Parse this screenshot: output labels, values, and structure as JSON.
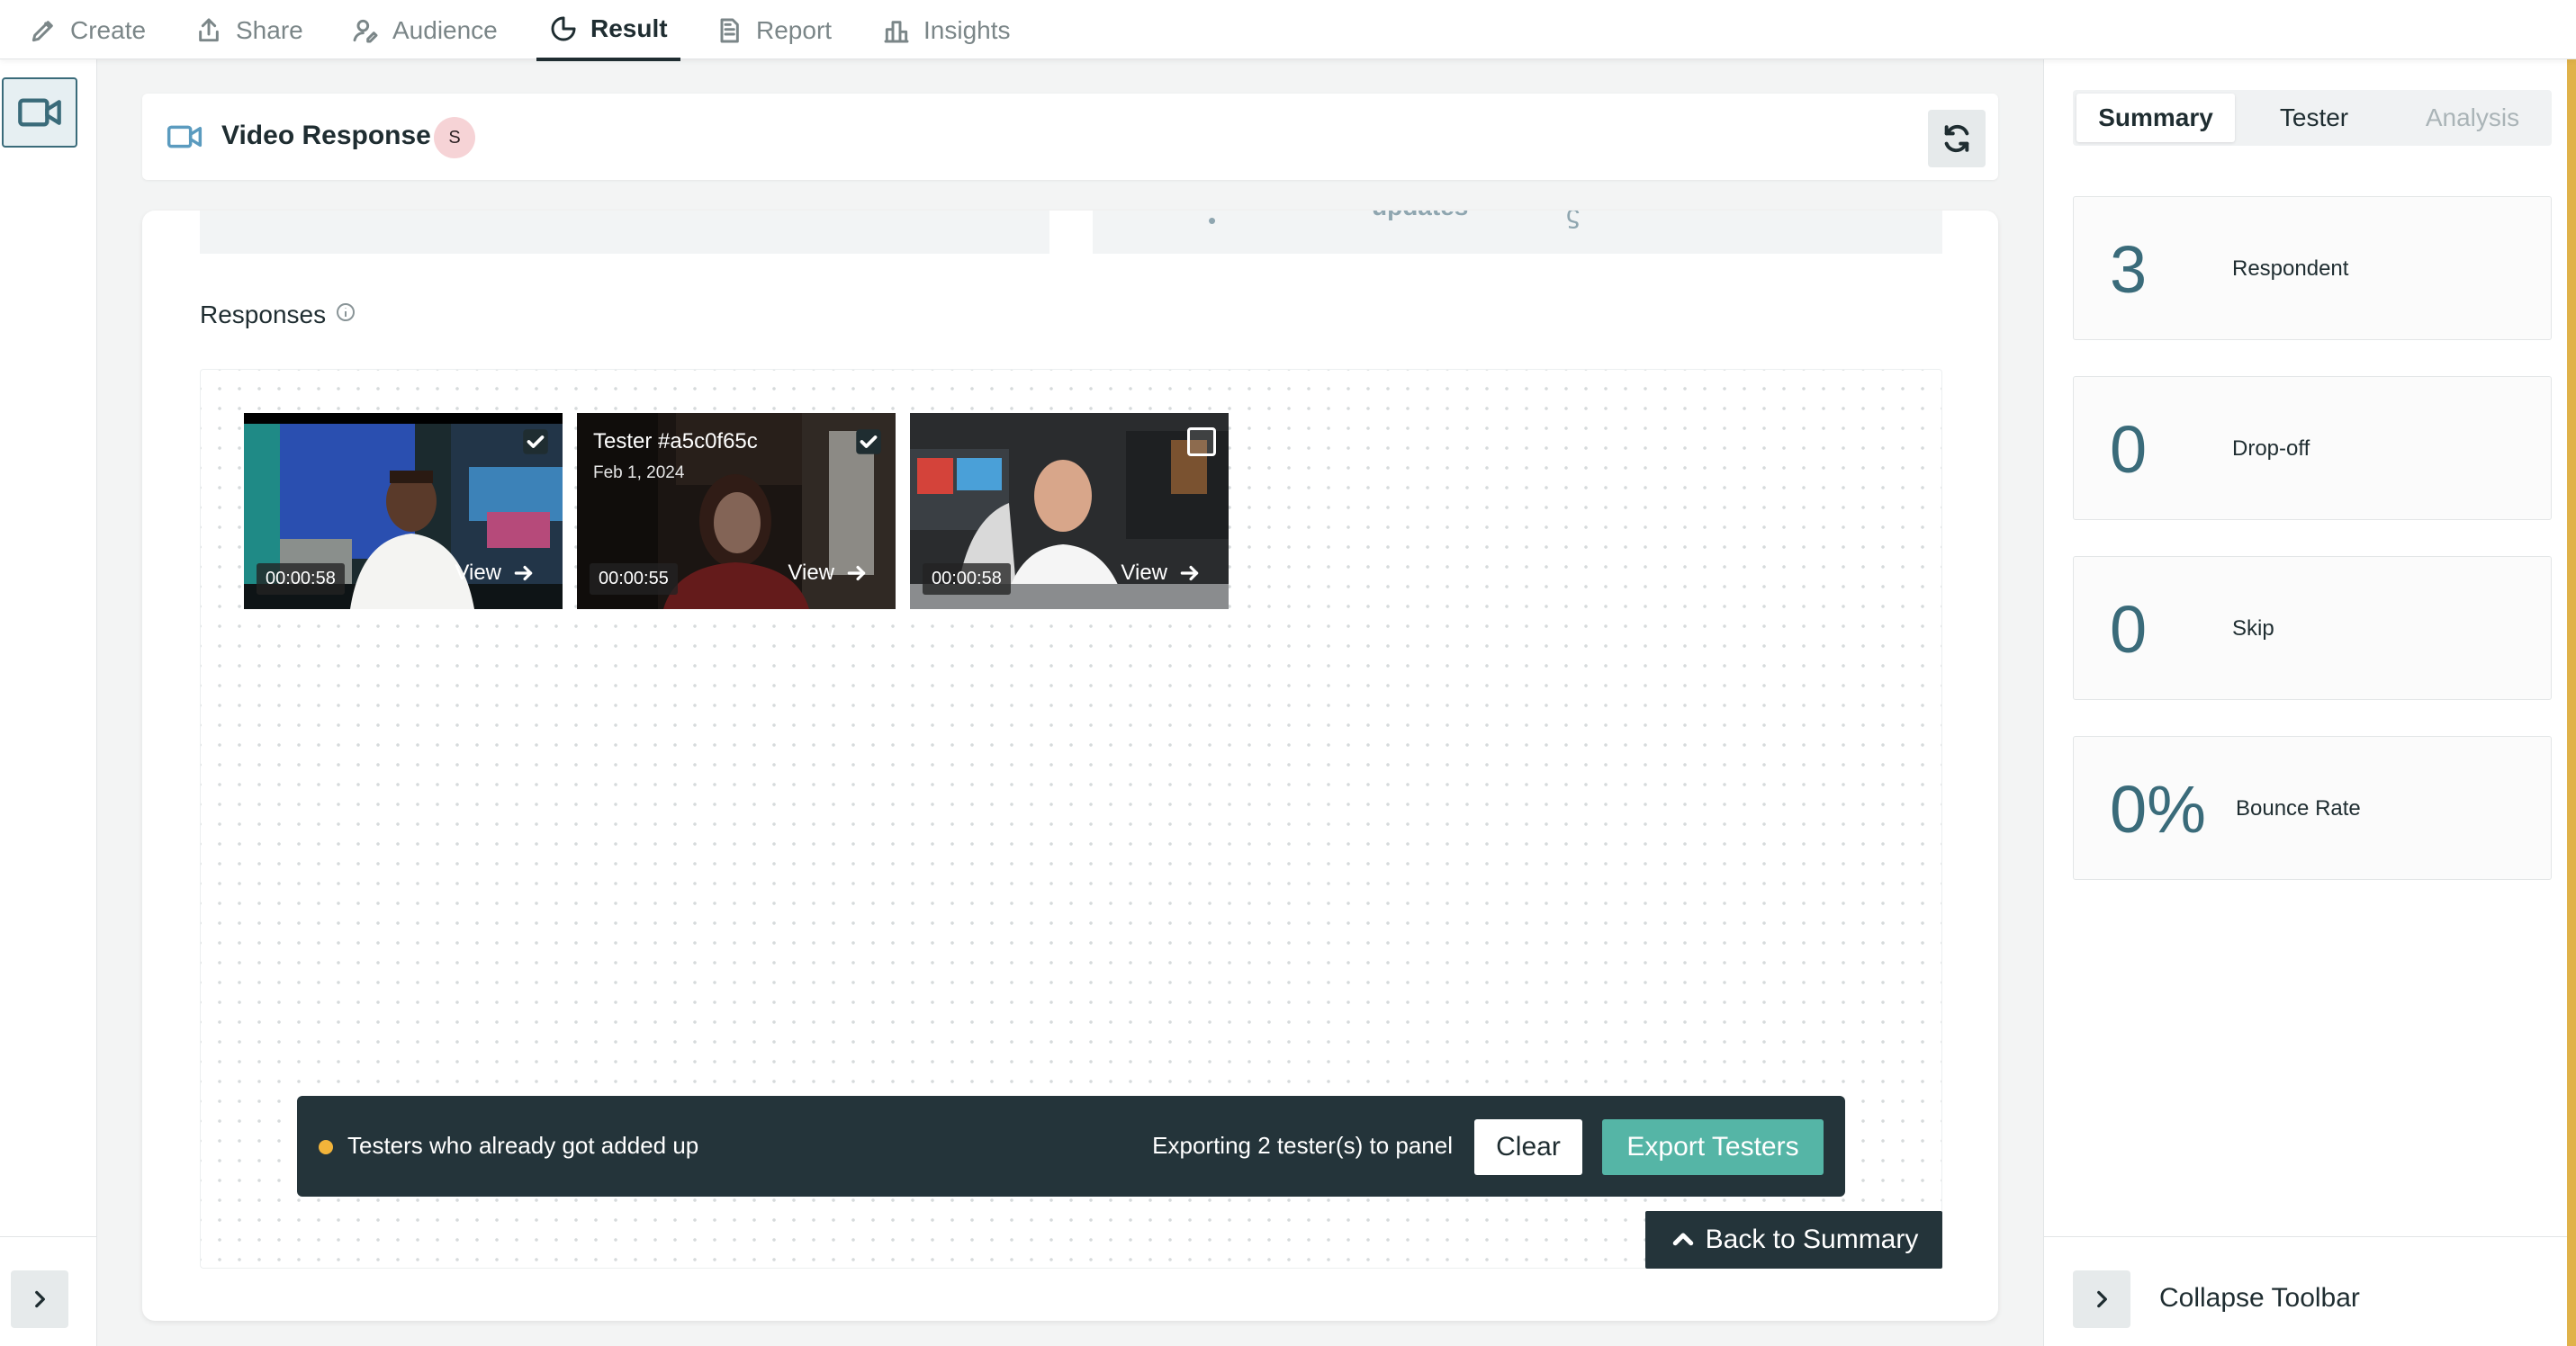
{
  "nav": {
    "tabs": [
      {
        "label": "Create",
        "icon": "pencil-icon"
      },
      {
        "label": "Share",
        "icon": "share-icon"
      },
      {
        "label": "Audience",
        "icon": "audience-icon"
      },
      {
        "label": "Result",
        "icon": "pie-chart-icon",
        "active": true
      },
      {
        "label": "Report",
        "icon": "document-icon"
      },
      {
        "label": "Insights",
        "icon": "bar-chart-icon"
      }
    ]
  },
  "header": {
    "title": "Video Response",
    "avatar_initial": "S"
  },
  "preview_strip": {
    "partial_text": "updates"
  },
  "responses": {
    "label": "Responses",
    "videos": [
      {
        "duration": "00:00:58",
        "view_label": "View",
        "checked": true
      },
      {
        "duration": "00:00:55",
        "view_label": "View",
        "checked": true,
        "tester_name": "Tester #a5c0f65c",
        "date": "Feb  1, 2024"
      },
      {
        "duration": "00:00:58",
        "view_label": "View",
        "checked": false
      }
    ]
  },
  "export_bar": {
    "warning": "Testers who already got added up",
    "info": "Exporting 2 tester(s) to panel",
    "clear_label": "Clear",
    "export_label": "Export Testers",
    "warning_color": "#f2b43a",
    "export_color": "#55b5a6"
  },
  "back_button": {
    "label": "Back to Summary"
  },
  "right_panel": {
    "tabs": [
      {
        "label": "Summary",
        "state": "active"
      },
      {
        "label": "Tester",
        "state": "normal"
      },
      {
        "label": "Analysis",
        "state": "disabled"
      }
    ],
    "stats": [
      {
        "value": "3",
        "label": "Respondent"
      },
      {
        "value": "0",
        "label": "Drop-off"
      },
      {
        "value": "0",
        "label": "Skip"
      },
      {
        "value": "0%",
        "label": "Bounce Rate"
      }
    ],
    "collapse_label": "Collapse Toolbar"
  }
}
